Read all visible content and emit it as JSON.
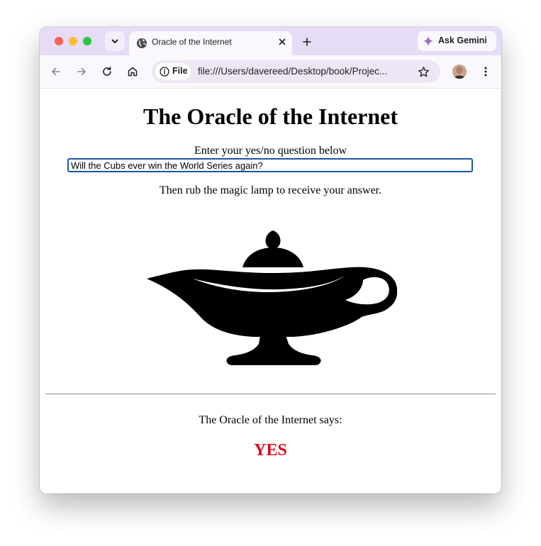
{
  "browser": {
    "tab": {
      "title": "Oracle of the Internet",
      "favicon": "globe-icon"
    },
    "gemini_label": "Ask Gemini",
    "site_chip_label": "File",
    "url": "file:///Users/davereed/Desktop/book/Projec...",
    "icons": [
      "tab-list-icon",
      "close-icon",
      "plus-icon",
      "back-icon",
      "forward-icon",
      "reload-icon",
      "home-icon",
      "info-icon",
      "star-icon",
      "avatar",
      "more-vert-icon",
      "gemini-sparkle-icon"
    ],
    "colors": {
      "titlebar": "#e6dcf5",
      "toolbar": "#faf8fd",
      "omnibox": "#ede7f5"
    }
  },
  "page": {
    "title": "The Oracle of the Internet",
    "prompt": "Enter your yes/no question below",
    "question_value": "Will the Cubs ever win the World Series again?",
    "instruction": "Then rub the magic lamp to receive your answer.",
    "lamp_image": "magic-lamp",
    "result_label": "The Oracle of the Internet says:",
    "answer": "YES",
    "colors": {
      "answer": "#e0081b",
      "input_border": "#1a56a8"
    }
  }
}
